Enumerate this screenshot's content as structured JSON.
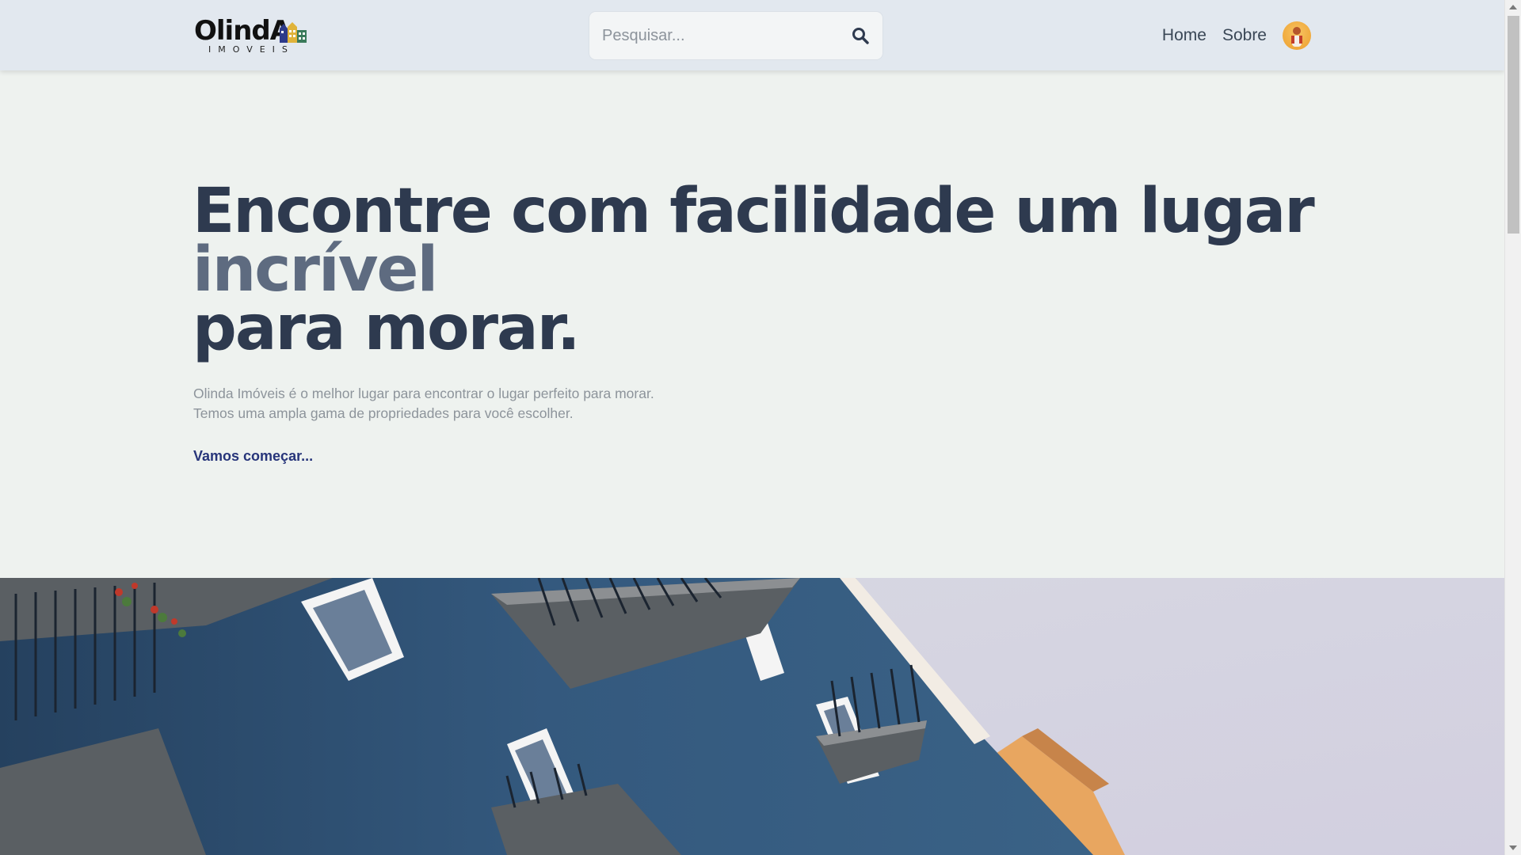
{
  "header": {
    "logo": {
      "wordmark": "OlindA",
      "subtitle": "IMOVEIS"
    },
    "search": {
      "placeholder": "Pesquisar...",
      "value": ""
    },
    "nav": {
      "items": [
        {
          "label": "Home"
        },
        {
          "label": "Sobre"
        }
      ]
    }
  },
  "hero": {
    "headline_line1": "Encontre com facilidade um lugar",
    "headline_accent": "incrível",
    "headline_line3": "para morar.",
    "lead_line1": "Olinda Imóveis é o melhor lugar para encontrar o lugar perfeito para morar.",
    "lead_line2": "Temos uma ampla gama de propriedades para você escolher.",
    "cta_label": "Vamos começar..."
  },
  "colors": {
    "header_bg": "#e2e8ef",
    "hero_bg": "#eef2ef",
    "headline": "#2e3a4f",
    "accent": "#5e6b80",
    "cta": "#27357a",
    "building_blue": "#2f4d6e"
  },
  "icons": {
    "search": "search-icon",
    "avatar": "user-avatar"
  }
}
